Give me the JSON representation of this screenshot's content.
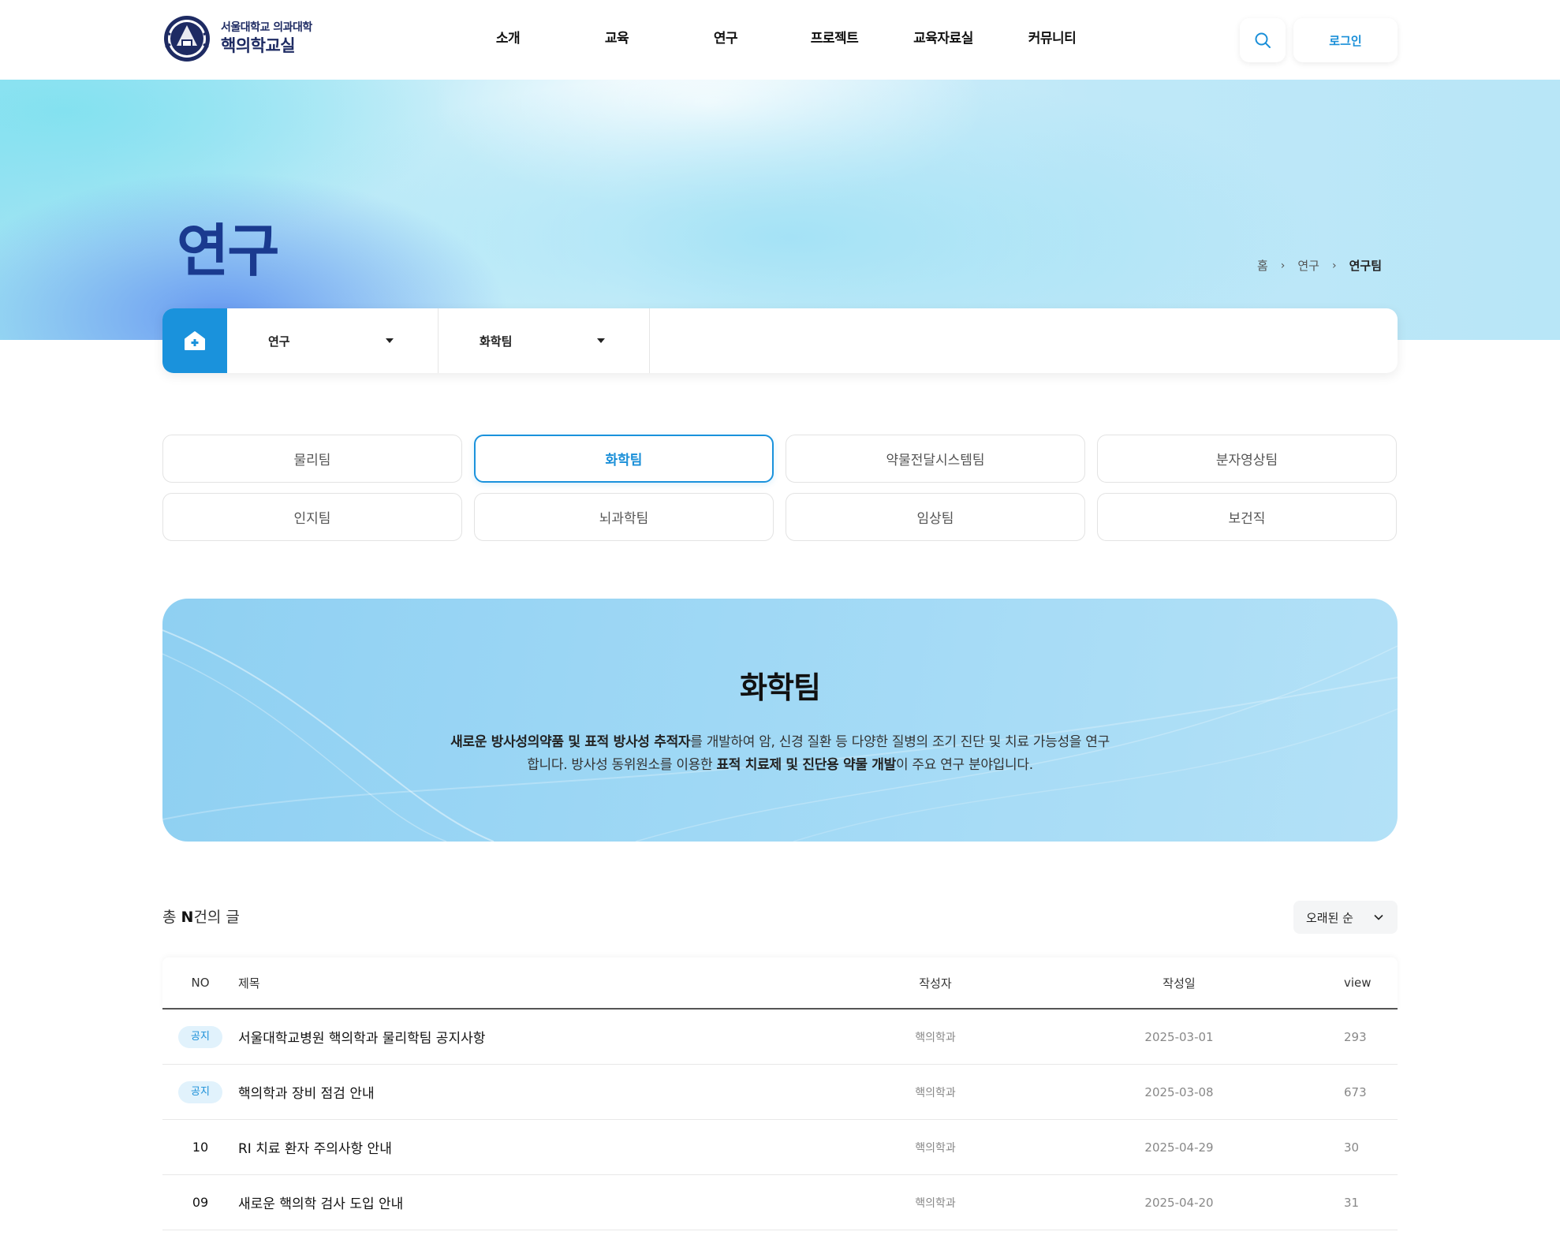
{
  "header": {
    "logo_sub": "서울대학교 의과대학",
    "logo_main": "핵의학교실",
    "nav": [
      "소개",
      "교육",
      "연구",
      "프로젝트",
      "교육자료실",
      "커뮤니티"
    ],
    "login": "로그인"
  },
  "hero": {
    "title": "연구",
    "breadcrumb": [
      "홈",
      "연구",
      "연구팀"
    ]
  },
  "subnav": {
    "depth1": "연구",
    "depth2": "화학팀"
  },
  "tabs": [
    "물리팀",
    "화학팀",
    "약물전달시스템팀",
    "분자영상팀",
    "인지팀",
    "뇌과학팀",
    "임상팀",
    "보건직"
  ],
  "active_tab": "화학팀",
  "banner": {
    "title": "화학팀",
    "desc_1_bold": "새로운 방사성의약품 및 표적 방사성 추적자",
    "desc_1": "를 개발하여 암, 신경 질환 등 다양한 질병의 조기 진단 및 치료 가능성을 연구합니다. 방사성 동위원소를 이용한 ",
    "desc_2_bold": "표적 치료제 및 진단용 약물 개발",
    "desc_2": "이 주요 연구 분야입니다."
  },
  "list": {
    "total_prefix": "총 ",
    "total_count": "N",
    "total_suffix": "건의 글",
    "sort": "오래된 순",
    "columns": {
      "no": "NO",
      "title": "제목",
      "author": "작성자",
      "date": "작성일",
      "view": "view"
    },
    "rows": [
      {
        "no": "공지",
        "notice": true,
        "title": "서울대학교병원 핵의학과 물리학팀 공지사항",
        "author": "핵의학과",
        "date": "2025-03-01",
        "view": "293"
      },
      {
        "no": "공지",
        "notice": true,
        "title": "핵의학과 장비 점검 안내",
        "author": "핵의학과",
        "date": "2025-03-08",
        "view": "673"
      },
      {
        "no": "10",
        "notice": false,
        "title": "RI 치료 환자 주의사항 안내",
        "author": "핵의학과",
        "date": "2025-04-29",
        "view": "30"
      },
      {
        "no": "09",
        "notice": false,
        "title": "새로운 핵의학 검사 도입 안내",
        "author": "핵의학과",
        "date": "2025-04-20",
        "view": "31"
      }
    ]
  },
  "colors": {
    "accent": "#1a92dc",
    "navy": "#1a3a8f",
    "badge_bg": "#e1f2fc"
  }
}
